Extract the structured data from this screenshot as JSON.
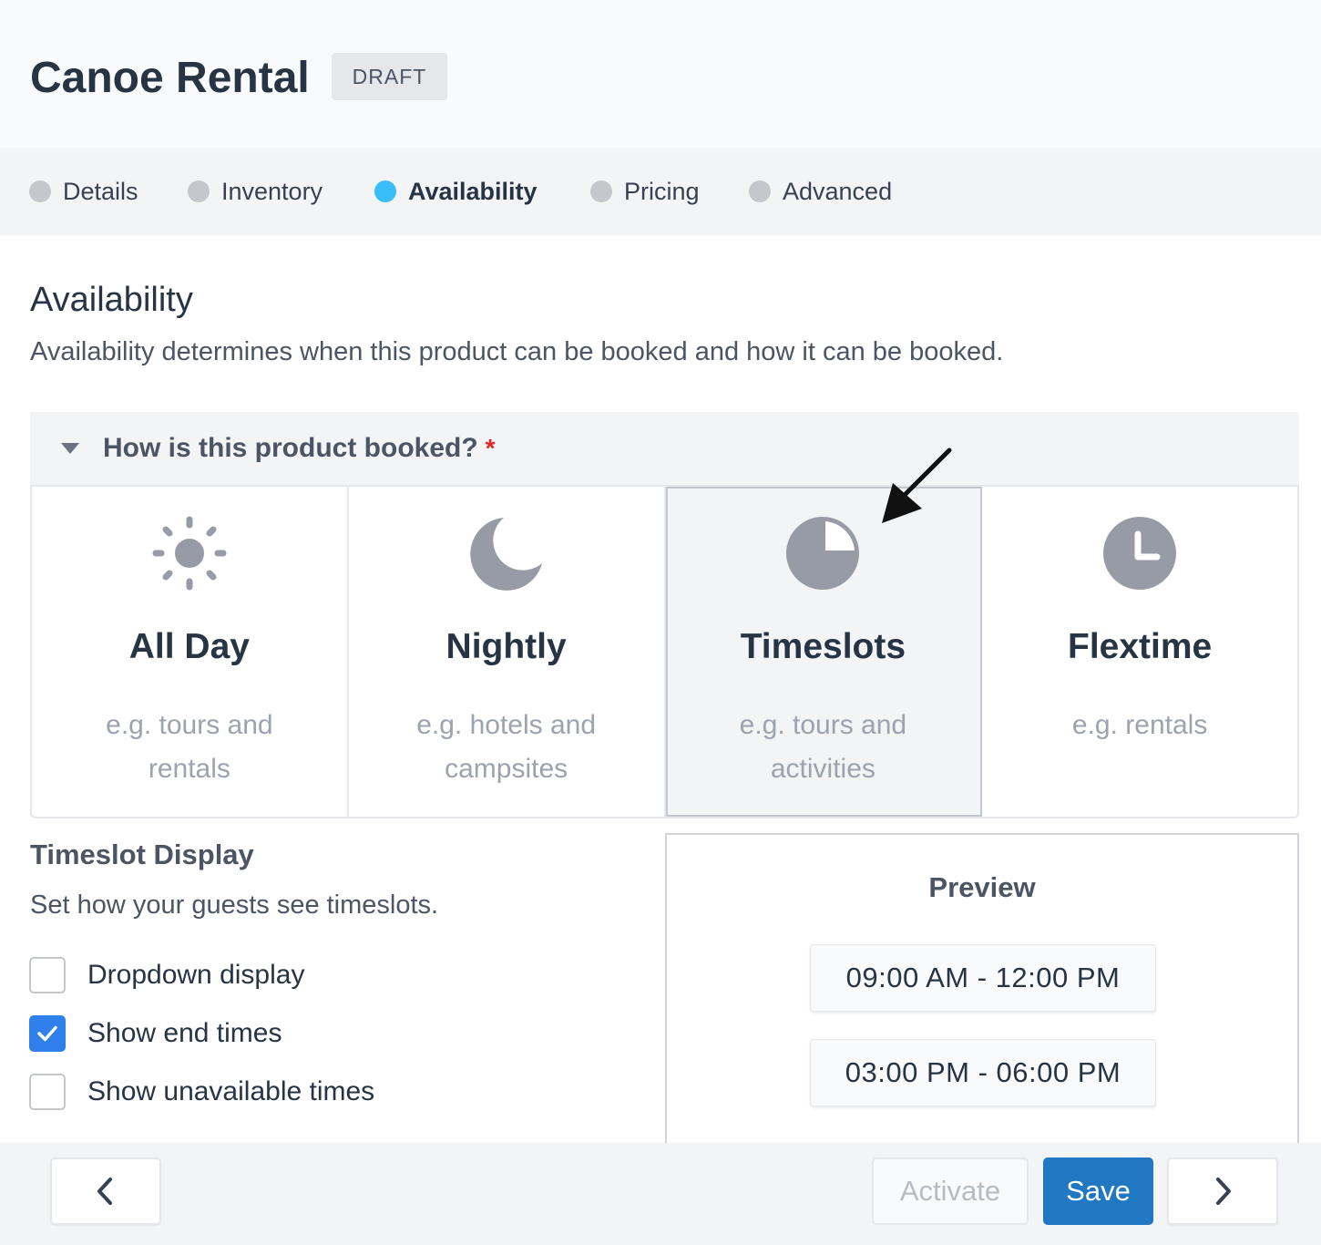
{
  "header": {
    "title": "Canoe Rental",
    "status_badge": "DRAFT"
  },
  "steps": [
    {
      "label": "Details",
      "active": false
    },
    {
      "label": "Inventory",
      "active": false
    },
    {
      "label": "Availability",
      "active": true
    },
    {
      "label": "Pricing",
      "active": false
    },
    {
      "label": "Advanced",
      "active": false
    }
  ],
  "section": {
    "title": "Availability",
    "description": "Availability determines when this product can be booked and how it can be booked."
  },
  "question": {
    "label": "How is this product booked?",
    "required_mark": "*"
  },
  "booking_types": [
    {
      "title": "All Day",
      "subtitle": "e.g. tours and rentals",
      "icon": "sun-icon",
      "selected": false
    },
    {
      "title": "Nightly",
      "subtitle": "e.g. hotels and campsites",
      "icon": "moon-icon",
      "selected": false
    },
    {
      "title": "Timeslots",
      "subtitle": "e.g. tours and activities",
      "icon": "pie-clock-icon",
      "selected": true
    },
    {
      "title": "Flextime",
      "subtitle": "e.g. rentals",
      "icon": "clock-icon",
      "selected": false
    }
  ],
  "timeslot_display": {
    "title": "Timeslot Display",
    "description": "Set how your guests see timeslots.",
    "options": [
      {
        "label": "Dropdown display",
        "checked": false
      },
      {
        "label": "Show end times",
        "checked": true
      },
      {
        "label": "Show unavailable times",
        "checked": false
      }
    ]
  },
  "preview": {
    "title": "Preview",
    "slots": [
      "09:00 AM - 12:00 PM",
      "03:00 PM - 06:00 PM"
    ]
  },
  "footer": {
    "activate_label": "Activate",
    "save_label": "Save",
    "prev_icon": "chevron-left-icon",
    "next_icon": "chevron-right-icon"
  },
  "colors": {
    "active_step": "#38bdf8",
    "primary": "#1f78c1",
    "checkbox_checked": "#2f80ed",
    "required": "#dc2626",
    "icon_gray": "#979ba5"
  }
}
